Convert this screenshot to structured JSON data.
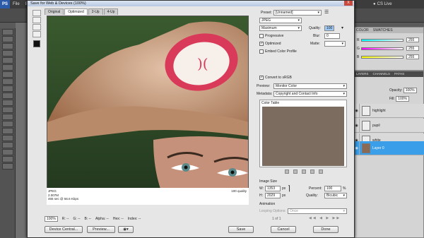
{
  "app": {
    "logo": "PS",
    "menu": [
      "File",
      "Edit"
    ],
    "cs_live": "CS Live"
  },
  "dialog": {
    "title": "Save for Web & Devices (100%)",
    "close": "X",
    "tabs": [
      "Original",
      "Optimized",
      "2-Up",
      "4-Up"
    ],
    "active_tab": "Optimized",
    "preview_info": {
      "format": "JPEG",
      "size": "2.007M",
      "time": "465 sec @ 56.6 Kbps",
      "quality": "100 quality"
    },
    "bottom_bar": {
      "zoom": "100%",
      "r": "R: --",
      "g": "G: --",
      "b": "B: --",
      "alpha": "Alpha: --",
      "hex": "Hex: --",
      "index": "Index: --"
    },
    "buttons": {
      "device_central": "Device Central...",
      "preview": "Preview...",
      "save": "Save",
      "cancel": "Cancel",
      "done": "Done"
    },
    "settings": {
      "preset_label": "Preset:",
      "preset_value": "[Unnamed]",
      "format": "JPEG",
      "compression": "Maximum",
      "quality_label": "Quality:",
      "quality_value": "100",
      "progressive": "Progressive",
      "blur_label": "Blur:",
      "blur_value": "0",
      "optimized": "Optimized",
      "matte_label": "Matte:",
      "embed_profile": "Embed Color Profile",
      "convert_srgb": "Convert to sRGB",
      "preview_label": "Preview:",
      "preview_value": "Monitor Color",
      "metadata_label": "Metadata:",
      "metadata_value": "Copyright and Contact Info",
      "color_table": "Color Table",
      "image_size": "Image Size",
      "w_label": "W:",
      "w_value": "1353",
      "h_label": "H:",
      "h_value": "2029",
      "px": "px",
      "percent_label": "Percent:",
      "percent_value": "100",
      "percent_unit": "%",
      "quality2_label": "Quality:",
      "quality2_value": "Bicubic",
      "animation": "Animation",
      "looping_label": "Looping Options:",
      "looping_value": "Once",
      "frame_counter": "1 of 1"
    }
  },
  "color_panel": {
    "tabs": [
      "COLOR",
      "SWATCHES"
    ],
    "rows": [
      {
        "label": "R",
        "value": "255"
      },
      {
        "label": "G",
        "value": "255"
      },
      {
        "label": "B",
        "value": "255"
      }
    ]
  },
  "layers_panel": {
    "tabs": [
      "LAYERS",
      "CHANNELS",
      "PATHS"
    ],
    "opacity_label": "Opacity:",
    "opacity_value": "100%",
    "fill_label": "Fill:",
    "fill_value": "100%",
    "layers": [
      {
        "name": "highlight",
        "selected": false
      },
      {
        "name": "pupil",
        "selected": false
      },
      {
        "name": "white",
        "selected": false
      },
      {
        "name": "Layer 0",
        "selected": true
      }
    ]
  }
}
